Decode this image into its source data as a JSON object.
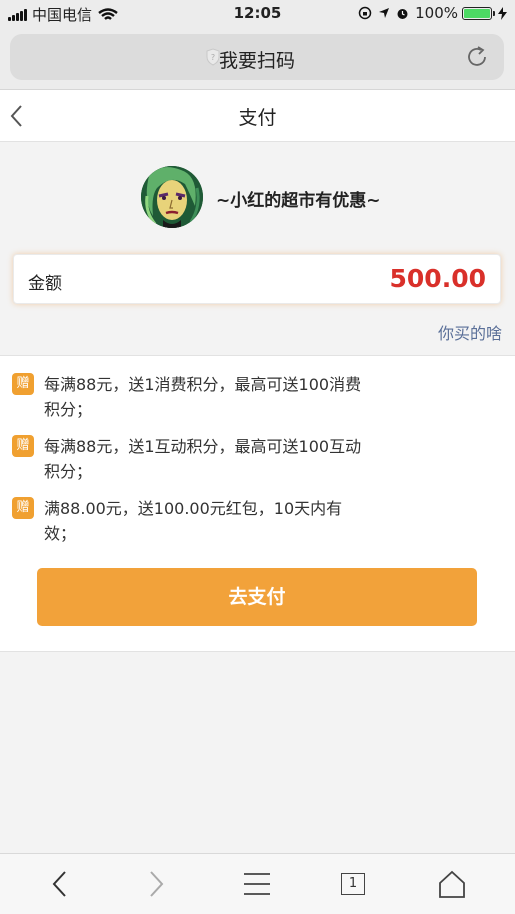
{
  "status_bar": {
    "carrier": "中国电信",
    "time": "12:05",
    "battery_percent": "100%",
    "battery_level": 1.0
  },
  "browser": {
    "url_title": "我要扫码"
  },
  "header": {
    "title": "支付"
  },
  "merchant": {
    "name": "~小红的超市有优惠~"
  },
  "amount": {
    "label": "金额",
    "value": "500.00"
  },
  "link": {
    "what_bought": "你买的啥"
  },
  "promotions": [
    {
      "badge": "赠",
      "text": "每满88元，送1消费积分，最高可送100消费积分；"
    },
    {
      "badge": "赠",
      "text": "每满88元，送1互动积分，最高可送100互动积分；"
    },
    {
      "badge": "赠",
      "text": "满88.00元，送100.00元红包，10天内有效；"
    }
  ],
  "pay_button": {
    "label": "去支付"
  },
  "toolbar": {
    "tab_count": "1"
  },
  "colors": {
    "accent": "#f2a23a",
    "amount_red": "#d9302a",
    "link_blue": "#5a6f98"
  },
  "icons": [
    "signal-icon",
    "wifi-icon",
    "lock-rotation-icon",
    "location-icon",
    "alarm-icon",
    "battery-icon",
    "charging-icon",
    "shield-icon",
    "reload-icon",
    "back-icon",
    "toolbar-back-icon",
    "toolbar-forward-icon",
    "menu-icon",
    "tabs-icon",
    "home-icon"
  ]
}
